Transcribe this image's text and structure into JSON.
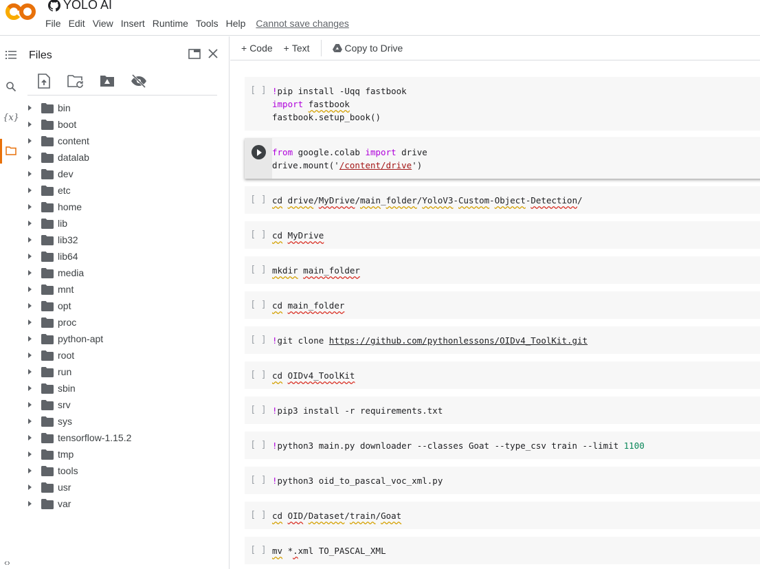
{
  "app": {
    "title": "YOLO AI",
    "menu": [
      "File",
      "Edit",
      "View",
      "Insert",
      "Runtime",
      "Tools",
      "Help"
    ],
    "save_status": "Cannot save changes",
    "brand_color": "#e8710a"
  },
  "rail": {
    "icons": [
      "toc-icon",
      "search-icon",
      "variables-icon",
      "files-icon"
    ],
    "bottom_toggle": "‹›"
  },
  "files": {
    "title": "Files",
    "toolbar": [
      "upload-icon",
      "refresh-icon",
      "mount-drive-icon",
      "hide-files-icon"
    ],
    "folders": [
      "bin",
      "boot",
      "content",
      "datalab",
      "dev",
      "etc",
      "home",
      "lib",
      "lib32",
      "lib64",
      "media",
      "mnt",
      "opt",
      "proc",
      "python-apt",
      "root",
      "run",
      "sbin",
      "srv",
      "sys",
      "tensorflow-1.15.2",
      "tmp",
      "tools",
      "usr",
      "var"
    ]
  },
  "notebook_toolbar": {
    "add_code": "Code",
    "add_text": "Text",
    "copy_to_drive": "Copy to Drive"
  },
  "cells": [
    {
      "gutter": "[ ]",
      "lines": [
        "!pip install -Uqq fastbook",
        "import fastbook",
        "fastbook.setup_book()"
      ]
    },
    {
      "gutter": "run",
      "lines": [
        "from google.colab import drive",
        "drive.mount('/content/drive')"
      ]
    },
    {
      "gutter": "[ ]",
      "lines": [
        "cd drive/MyDrive/main_folder/YoloV3-Custom-Object-Detection/"
      ]
    },
    {
      "gutter": "[ ]",
      "lines": [
        "cd MyDrive"
      ]
    },
    {
      "gutter": "[ ]",
      "lines": [
        "mkdir main_folder"
      ]
    },
    {
      "gutter": "[ ]",
      "lines": [
        "cd main_folder"
      ]
    },
    {
      "gutter": "[ ]",
      "lines": [
        "!git clone https://github.com/pythonlessons/OIDv4_ToolKit.git"
      ]
    },
    {
      "gutter": "[ ]",
      "lines": [
        "cd OIDv4_ToolKit"
      ]
    },
    {
      "gutter": "[ ]",
      "lines": [
        "!pip3 install -r requirements.txt"
      ]
    },
    {
      "gutter": "[ ]",
      "lines": [
        "!python3 main.py downloader --classes Goat --type_csv train --limit 1100"
      ]
    },
    {
      "gutter": "[ ]",
      "lines": [
        "!python3 oid_to_pascal_voc_xml.py"
      ]
    },
    {
      "gutter": "[ ]",
      "lines": [
        "cd OID/Dataset/train/Goat"
      ]
    },
    {
      "gutter": "[ ]",
      "lines": [
        "mv *.xml TO_PASCAL_XML"
      ]
    }
  ]
}
